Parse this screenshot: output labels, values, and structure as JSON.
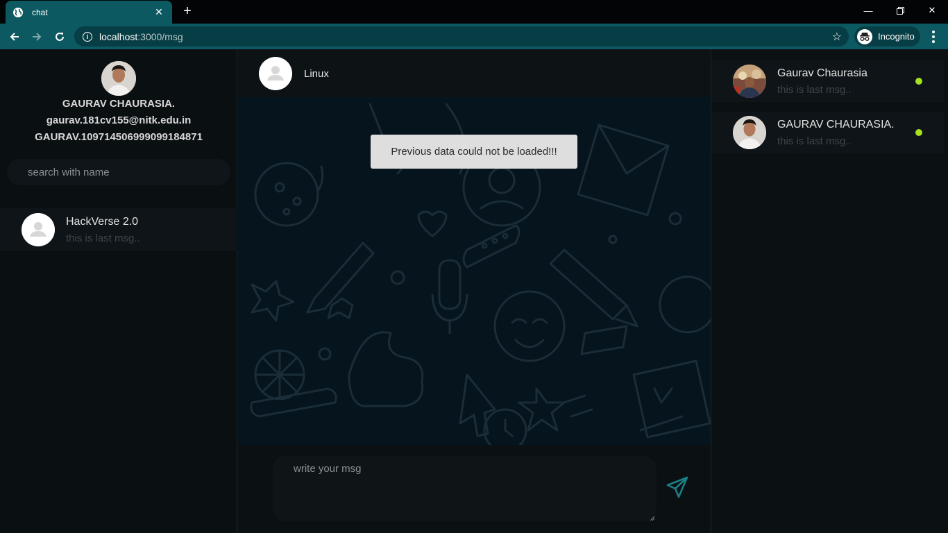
{
  "browser": {
    "tab_title": "chat",
    "url_host": "localhost",
    "url_path": ":3000/msg",
    "incognito_label": "Incognito"
  },
  "profile": {
    "name": "GAURAV CHAURASIA.",
    "email": "gaurav.181cv155@nitk.edu.in",
    "id": "GAURAV.109714506999099184871"
  },
  "search": {
    "placeholder": "search with name"
  },
  "groups": [
    {
      "name": "HackVerse 2.0",
      "last_msg": "this is last msg.."
    }
  ],
  "chat": {
    "header_name": "Linux",
    "toast": "Previous data could not be loaded!!!",
    "compose_placeholder": "write your msg"
  },
  "online_users": [
    {
      "name": "Gaurav Chaurasia",
      "last_msg": "this is last msg..",
      "status": "online"
    },
    {
      "name": "GAURAV CHAURASIA.",
      "last_msg": "this is last msg..",
      "status": "online"
    }
  ],
  "colors": {
    "chrome_accent": "#0d5961",
    "online": "#a6e022",
    "send_icon": "#1b7f86"
  }
}
